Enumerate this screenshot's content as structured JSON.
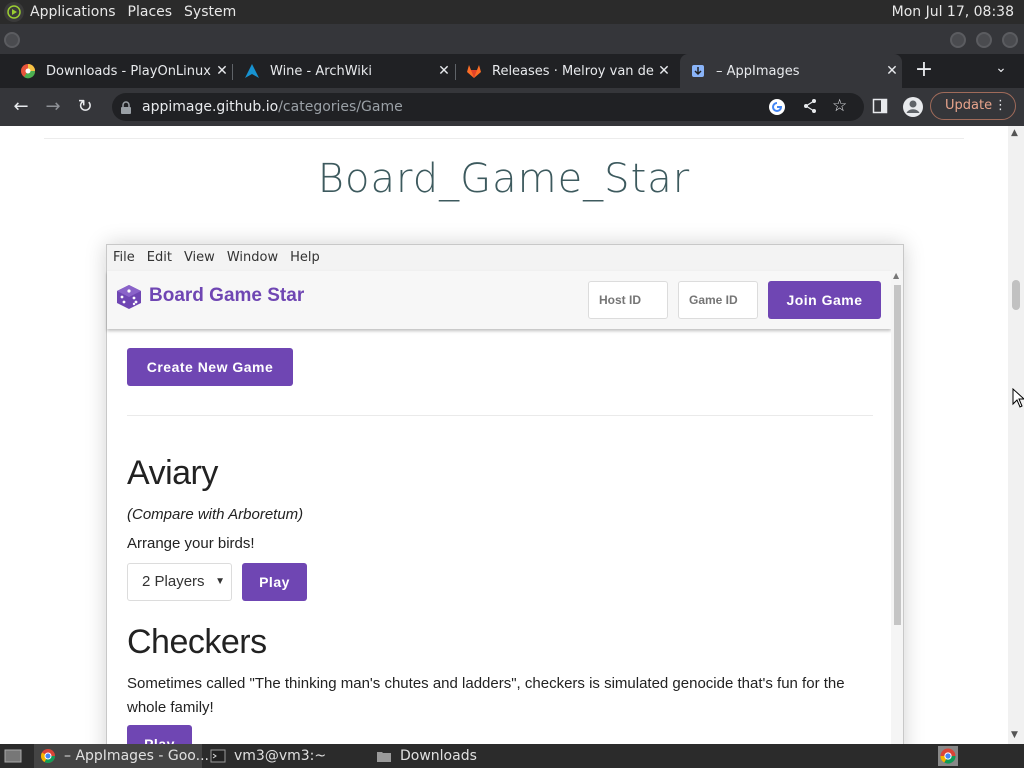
{
  "top_panel": {
    "menus": [
      "Applications",
      "Places",
      "System"
    ],
    "clock": "Mon Jul 17, 08:38"
  },
  "browser": {
    "tabs": [
      {
        "title": "Downloads - PlayOnLinux -",
        "icon": "playonlinux-icon"
      },
      {
        "title": "Wine - ArchWiki",
        "icon": "archlinux-icon"
      },
      {
        "title": "Releases · Melroy van den B",
        "icon": "gitlab-icon"
      },
      {
        "title": "– AppImages",
        "icon": "appimage-icon",
        "active": true
      }
    ],
    "address_host": "appimage.github.io",
    "address_path": "/categories/Game",
    "update_label": "Update"
  },
  "page": {
    "title": "Board_Game_Star"
  },
  "app": {
    "menu": [
      "File",
      "Edit",
      "View",
      "Window",
      "Help"
    ],
    "brand": "Board Game Star",
    "host_id_placeholder": "Host ID",
    "game_id_placeholder": "Game ID",
    "join_label": "Join Game",
    "create_label": "Create New Game",
    "games": [
      {
        "name": "Aviary",
        "note": "(Compare with Arboretum)",
        "description": "Arrange your birds!",
        "players": "2 Players",
        "play_label": "Play"
      },
      {
        "name": "Checkers",
        "description": "Sometimes called \"The thinking man's chutes and ladders\", checkers is simulated genocide that's fun for the whole family!",
        "play_label": "Play"
      }
    ]
  },
  "taskbar": {
    "items": [
      {
        "label": "– AppImages - Goo...",
        "icon": "chrome-icon"
      },
      {
        "label": "vm3@vm3:~",
        "icon": "terminal-icon"
      },
      {
        "label": "Downloads",
        "icon": "folder-icon"
      }
    ]
  },
  "colors": {
    "brand_purple": "#6f46b3",
    "title_teal": "#3d5a5e",
    "panel_dark": "#2b2b2b",
    "chrome_dark": "#35363a"
  }
}
